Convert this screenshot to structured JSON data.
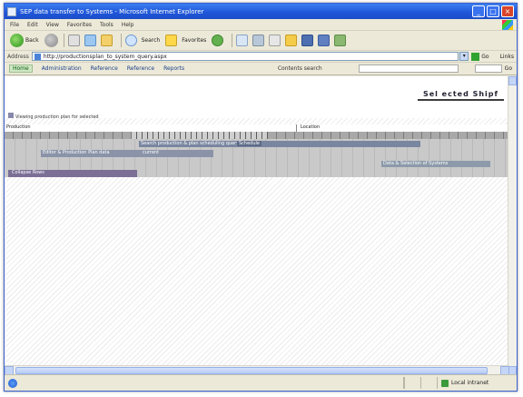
{
  "window": {
    "title": "SEP data transfer to Systems - Microsoft Internet Explorer"
  },
  "menubar": {
    "items": [
      "File",
      "Edit",
      "View",
      "Favorites",
      "Tools",
      "Help"
    ]
  },
  "toolbar": {
    "back_label": "Back",
    "search_label": "Search",
    "favorites_label": "Favorites"
  },
  "address": {
    "label": "Address",
    "url": "http://productionsplan_to_system_query.aspx",
    "go_label": "Go",
    "links_label": "Links"
  },
  "linksbar": {
    "tabs": [
      "Home",
      "Administration",
      "Reference",
      "Reference",
      "Reports"
    ],
    "search_label": "Contents search",
    "select_value": "Go"
  },
  "page": {
    "title_button": "Sel ected Shipf",
    "page_label": "Viewing production plan for selected",
    "field_left": "Production",
    "field_right": "Location",
    "rowA_label": "Search production & plan scheduling query",
    "rowA_tag": "Schedule",
    "rowB_label": "Editor & Production Plan data",
    "rowB_value": "current",
    "rowC_label": "Data & Selection of Systems",
    "rowD_label": "Collapse Rows"
  },
  "status": {
    "zone_label": "Local intranet"
  }
}
